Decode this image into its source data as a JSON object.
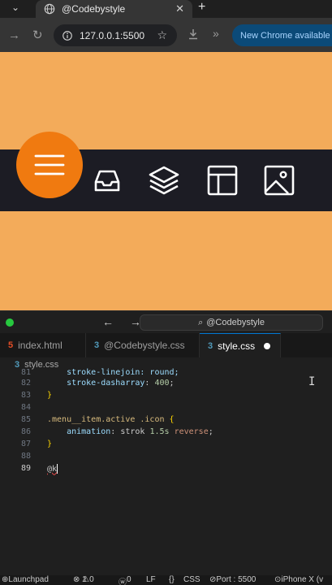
{
  "browser": {
    "tab_title": "@Codebystyle",
    "new_tab_icon": "plus",
    "url": "127.0.0.1:5500",
    "update_label": "New Chrome available"
  },
  "page": {
    "background_color": "#f3ab5a",
    "accent_color": "#f07a10",
    "menu_items": [
      {
        "icon": "hamburger-menu-icon",
        "active": true
      },
      {
        "icon": "inbox-tray-icon",
        "active": false
      },
      {
        "icon": "layers-icon",
        "active": false
      },
      {
        "icon": "layout-panel-icon",
        "active": false
      },
      {
        "icon": "image-icon",
        "active": false
      }
    ]
  },
  "vscode": {
    "command_center": "@Codebystyle",
    "tabs": [
      {
        "label": "index.html",
        "type": "html"
      },
      {
        "label": "@Codebystyle.css",
        "type": "css"
      },
      {
        "label": "style.css",
        "type": "css",
        "active": true,
        "modified": true
      }
    ],
    "breadcrumb": "style.css",
    "lines": [
      {
        "n": "81",
        "text": "    stroke-linejoin: round;"
      },
      {
        "n": "82",
        "text": "    stroke-dasharray: 400;"
      },
      {
        "n": "83",
        "text": "}"
      },
      {
        "n": "84",
        "text": ""
      },
      {
        "n": "85",
        "text": ".menu__item.active .icon {"
      },
      {
        "n": "86",
        "text": "    animation: strok 1.5s reverse;"
      },
      {
        "n": "87",
        "text": "}"
      },
      {
        "n": "88",
        "text": ""
      },
      {
        "n": "89",
        "text": "@k"
      }
    ],
    "status": {
      "launchpad": "Launchpad",
      "errors": "1",
      "warnings": "0",
      "info": "0",
      "ln": "LF",
      "braces": "{}",
      "lang": "CSS",
      "port": "Port : 5500",
      "device": "iPhone X (v"
    }
  }
}
